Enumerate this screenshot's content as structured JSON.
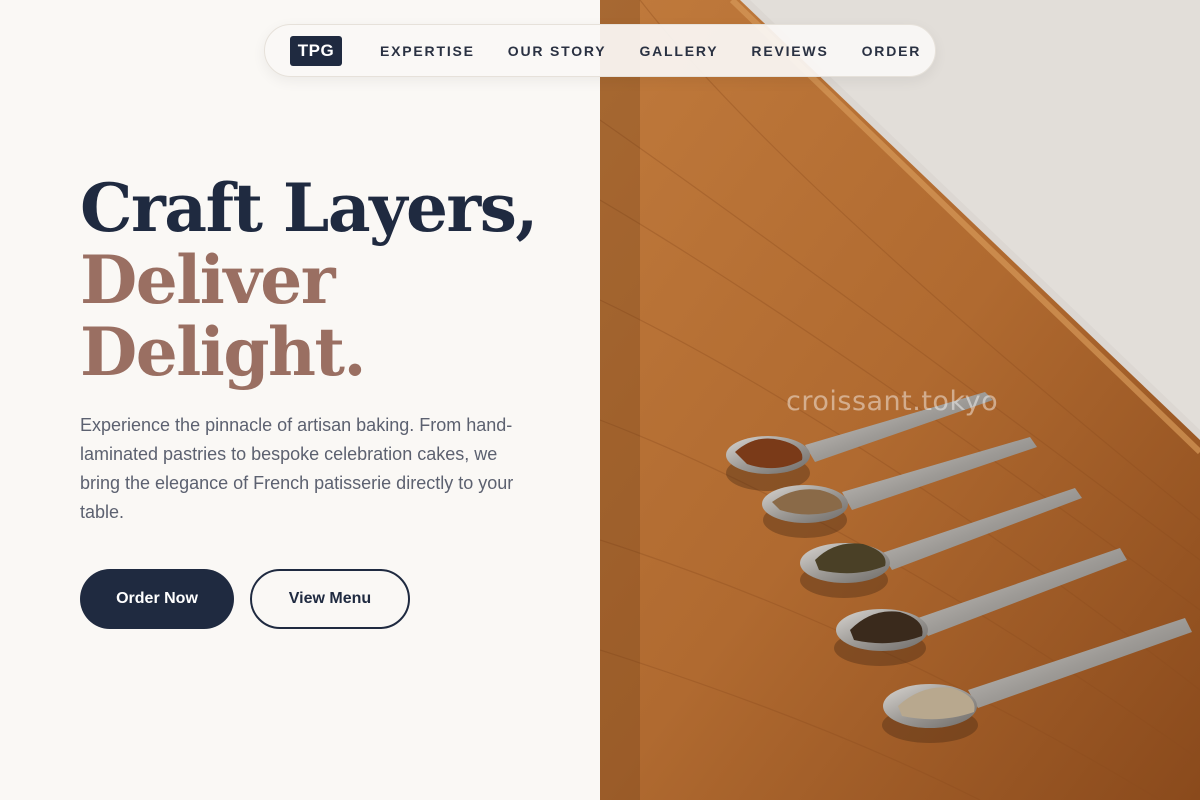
{
  "nav": {
    "logo": "TPG",
    "links": [
      "EXPERTISE",
      "OUR STORY",
      "GALLERY",
      "REVIEWS",
      "ORDER"
    ]
  },
  "hero": {
    "title_line1": "Craft Layers,",
    "title_line2": "Deliver",
    "title_line3": "Delight.",
    "description": "Experience the pinnacle of artisan baking. From hand-laminated pastries to bespoke celebration cakes, we bring the elegance of French patisserie directly to your table.",
    "primary_button": "Order Now",
    "secondary_button": "View Menu"
  },
  "image": {
    "watermark": "croissant.tokyo"
  },
  "colors": {
    "navy": "#1f2a40",
    "mocha": "#9a6f62",
    "background": "#faf8f5"
  }
}
